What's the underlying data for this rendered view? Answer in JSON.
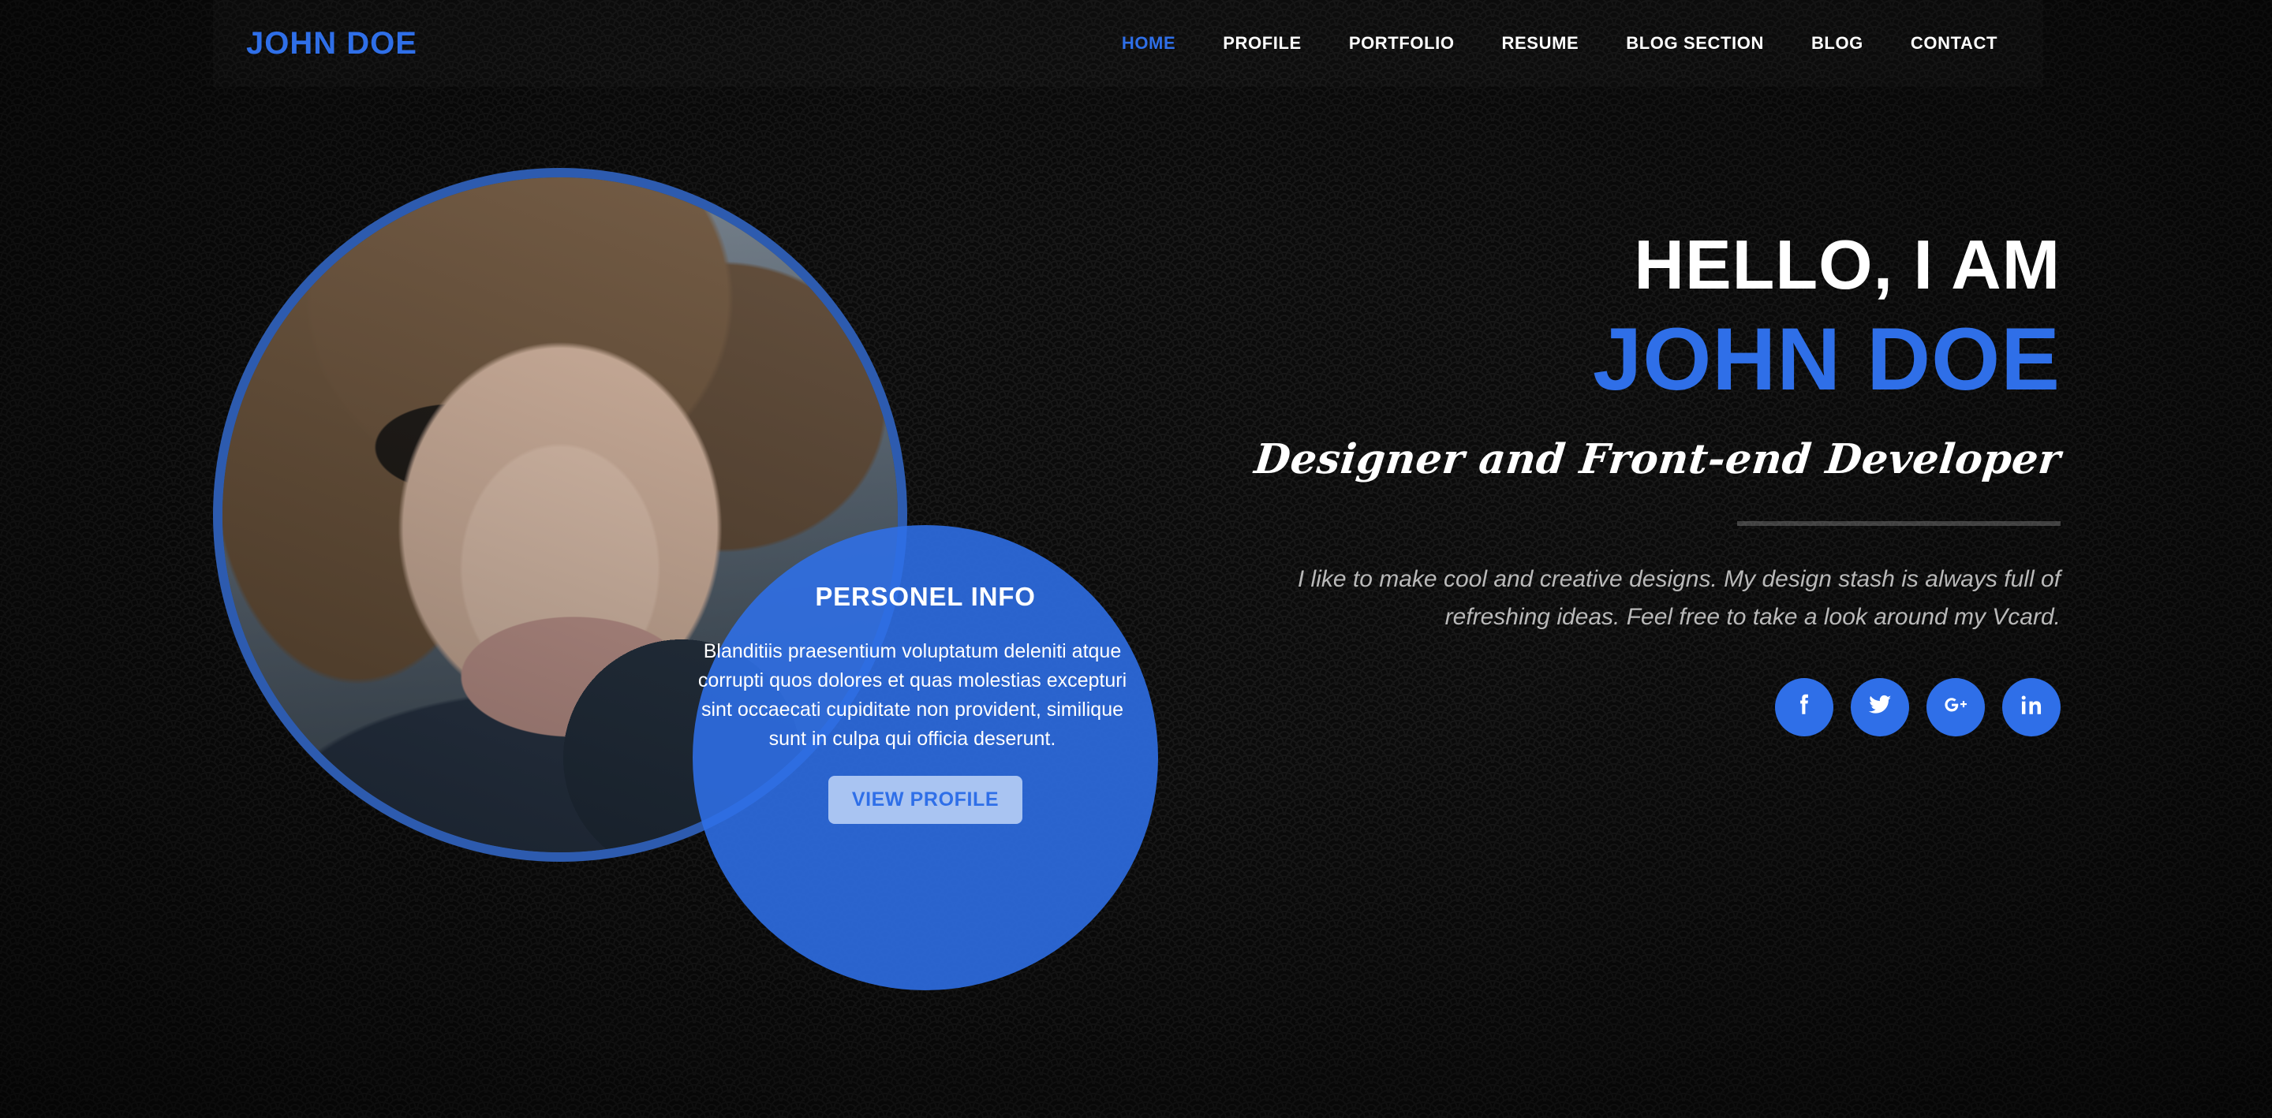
{
  "theme": {
    "accent": "#2f6fe8",
    "background": "#0b0b0b",
    "pattern_color": "#171717",
    "text_light": "#ffffff",
    "text_muted": "#b9b9b9",
    "button_bg": "#a9c4f2"
  },
  "header": {
    "brand": "JOHN DOE",
    "nav": [
      {
        "label": "HOME",
        "active": true
      },
      {
        "label": "PROFILE",
        "active": false
      },
      {
        "label": "PORTFOLIO",
        "active": false
      },
      {
        "label": "RESUME",
        "active": false
      },
      {
        "label": "BLOG SECTION",
        "active": false
      },
      {
        "label": "BLOG",
        "active": false
      },
      {
        "label": "CONTACT",
        "active": false
      }
    ]
  },
  "hero": {
    "greeting": "HELLO, I AM",
    "name": "JOHN DOE",
    "tagline": "Designer and Front-end Developer",
    "description": "I like to make cool and creative designs. My design stash is always full of refreshing ideas. Feel free to take a look around my Vcard.",
    "avatar_alt": "Portrait of a man wearing sunglasses"
  },
  "info_card": {
    "title": "PERSONEL INFO",
    "body": "Blanditiis praesentium voluptatum deleniti atque corrupti quos dolores et quas molestias excepturi sint occaecati cupiditate non provident, similique sunt in culpa qui officia deserunt.",
    "button_label": "VIEW PROFILE"
  },
  "socials": [
    {
      "name": "facebook",
      "icon": "facebook-icon"
    },
    {
      "name": "twitter",
      "icon": "twitter-icon"
    },
    {
      "name": "google-plus",
      "icon": "google-plus-icon"
    },
    {
      "name": "linkedin",
      "icon": "linkedin-icon"
    }
  ]
}
